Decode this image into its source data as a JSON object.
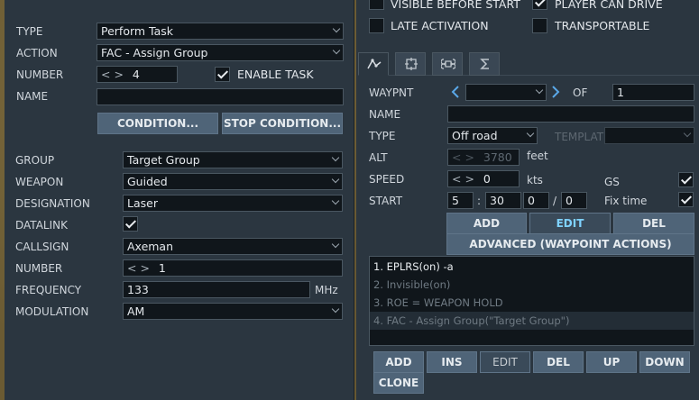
{
  "left": {
    "type_label": "TYPE",
    "type_value": "Perform Task",
    "action_label": "ACTION",
    "action_value": "FAC - Assign Group",
    "number_label": "NUMBER",
    "number_value": "4",
    "enable_task_label": "ENABLE TASK",
    "enable_task_checked": true,
    "name_label": "NAME",
    "name_value": "",
    "condition_button": "CONDITION...",
    "stop_condition_button": "STOP CONDITION...",
    "group_label": "GROUP",
    "group_value": "Target Group",
    "weapon_label": "WEAPON",
    "weapon_value": "Guided",
    "designation_label": "DESIGNATION",
    "designation_value": "Laser",
    "datalink_label": "DATALINK",
    "datalink_checked": true,
    "callsign_label": "CALLSIGN",
    "callsign_value": "Axeman",
    "callsign_number_label": "NUMBER",
    "callsign_number_value": "1",
    "frequency_label": "FREQUENCY",
    "frequency_value": "133",
    "frequency_unit": "MHz",
    "modulation_label": "MODULATION",
    "modulation_value": "AM",
    "stepper_glyph": "< >"
  },
  "right": {
    "visible_before_start_label": "VISIBLE BEFORE START",
    "player_can_drive_label": "PLAYER CAN DRIVE",
    "player_can_drive_checked": true,
    "late_activation_label": "LATE ACTIVATION",
    "late_activation_checked": false,
    "transportable_label": "TRANSPORTABLE",
    "transportable_checked": false,
    "tabs": [
      {
        "icon": "route-icon",
        "active": true
      },
      {
        "icon": "target-icon",
        "active": false
      },
      {
        "icon": "command-icon",
        "active": false
      },
      {
        "icon": "sigma-icon",
        "active": false
      }
    ],
    "waypoint_label": "WAYPNT",
    "waypoint_value": "",
    "of_label": "OF",
    "of_value": "1",
    "name_label": "NAME",
    "name_value": "",
    "type_label": "TYPE",
    "type_value": "Off road",
    "template_label": "TEMPLATE",
    "template_value": "",
    "alt_label": "ALT",
    "alt_value": "3780",
    "alt_unit": "feet",
    "speed_label": "SPEED",
    "speed_value": "0",
    "speed_unit": "kts",
    "gs_label": "GS",
    "gs_checked": true,
    "start_label": "START",
    "start_day": "5",
    "start_hour": "30",
    "start_min": "0",
    "start_sec": "0",
    "time_sep": ":",
    "slash_sep": "/",
    "fix_time_label": "Fix time",
    "fix_time_checked": true,
    "wp_add_button": "ADD",
    "wp_edit_button": "EDIT",
    "wp_del_button": "DEL",
    "advanced_button": "ADVANCED (WAYPOINT ACTIONS)",
    "actions": [
      "1. EPLRS(on)  -a",
      "2. Invisible(on)",
      "3. ROE = WEAPON HOLD",
      "4. FAC - Assign Group(\"Target Group\")"
    ],
    "bottom_buttons": {
      "add": "ADD",
      "ins": "INS",
      "edit": "EDIT",
      "del": "DEL",
      "up": "UP",
      "down": "DOWN",
      "clone": "CLONE"
    }
  },
  "colors": {
    "panel": "#2b3640",
    "field": "#10161b",
    "button": "#4f6478",
    "accent": "#7fd2ff"
  }
}
